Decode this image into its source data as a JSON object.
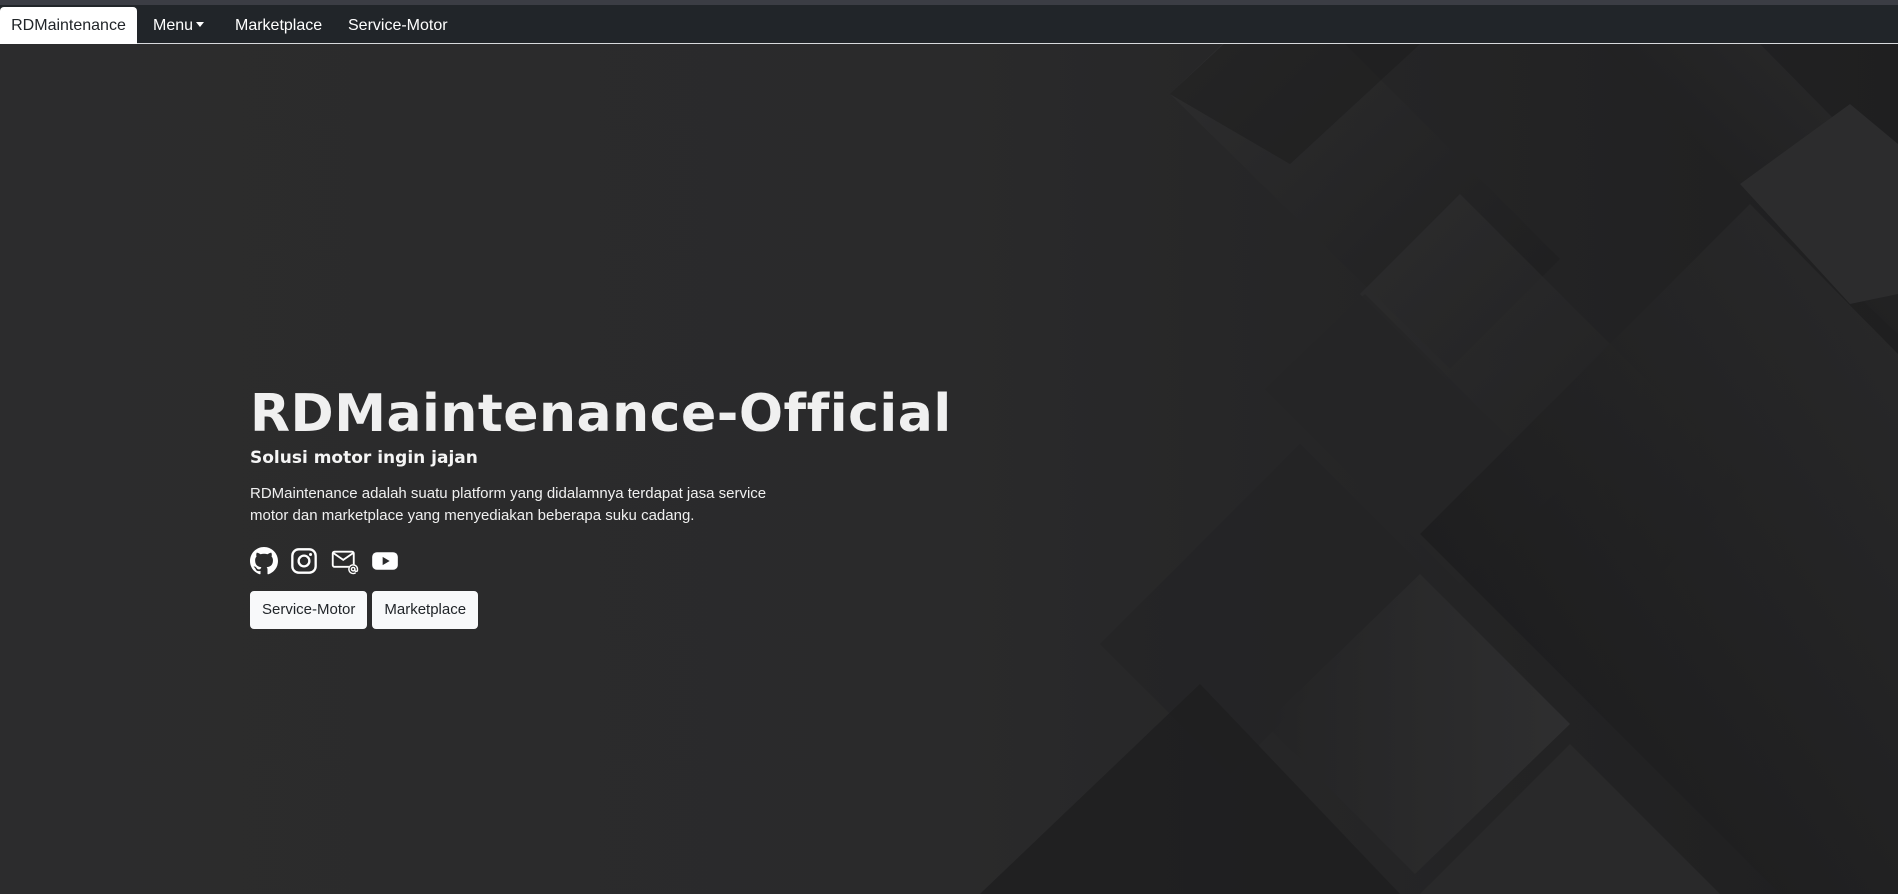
{
  "navbar": {
    "brand": "RDMaintenance",
    "items": [
      {
        "label": "Menu",
        "dropdown": true
      },
      {
        "label": "Marketplace"
      },
      {
        "label": "Service-Motor"
      }
    ]
  },
  "hero": {
    "title": "RDMaintenance-Official",
    "subtitle": "Solusi motor ingin jajan",
    "description": "RDMaintenance adalah suatu platform yang didalamnya terdapat jasa service motor dan marketplace yang menyediakan beberapa suku cadang.",
    "socials": [
      {
        "icon": "github-icon"
      },
      {
        "icon": "instagram-icon"
      },
      {
        "icon": "email-icon"
      },
      {
        "icon": "youtube-icon"
      }
    ],
    "buttons": {
      "service_motor": "Service-Motor",
      "marketplace": "Marketplace"
    }
  },
  "colors": {
    "navbar_bg": "#212529",
    "hero_bg": "#2a2a2b",
    "button_bg": "#f8f9fa",
    "text_light": "#f0f0f0"
  }
}
